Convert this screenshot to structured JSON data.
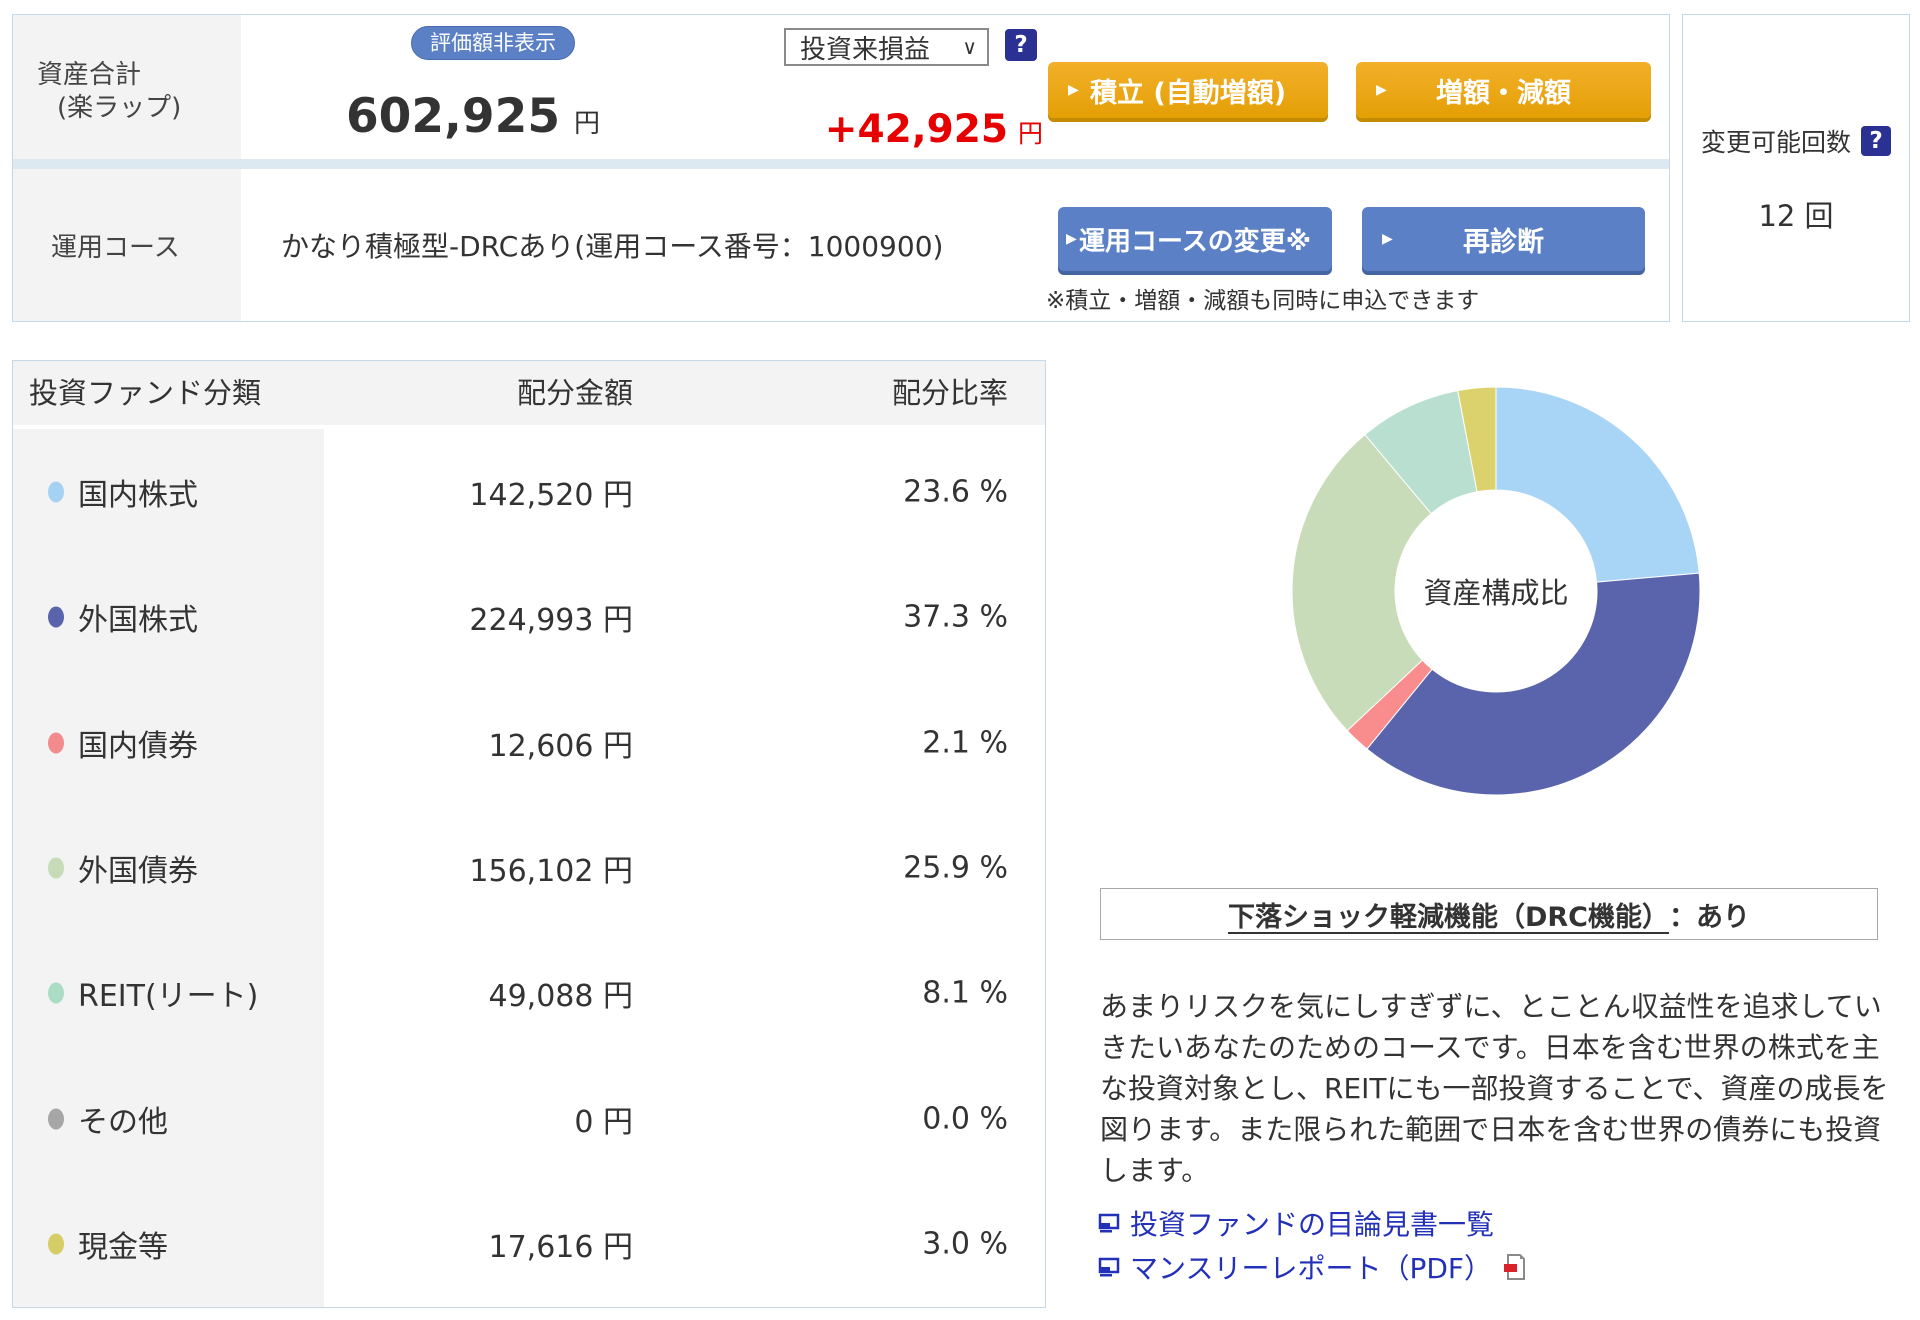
{
  "summary": {
    "asset_label_line1": "資産合計",
    "asset_label_line2": "(楽ラップ)",
    "hide_valuation_button": "評価額非表示",
    "total_amount": "602,925",
    "total_currency": "円",
    "pl_period_selected": "投資来損益",
    "pl_chevron": "∨",
    "pl_amount": "+42,925",
    "pl_currency": "円",
    "help_icon": "?",
    "arrow_icon": "▶",
    "accumulate_button": "積立 (自動増額)",
    "increase_decrease_button": "増額・減額"
  },
  "course": {
    "label": "運用コース",
    "value": "かなり積極型-DRCあり(運用コース番号：1000900)",
    "change_course_button": "運用コースの変更※",
    "rediagnose_button": "再診断",
    "note": "※積立・増額・減額も同時に申込できます"
  },
  "change_limit": {
    "label": "変更可能回数",
    "help_icon": "?",
    "value": "12 回"
  },
  "allocation_table": {
    "headers": [
      "投資ファンド分類",
      "配分金額",
      "配分比率"
    ],
    "rows": [
      {
        "label": "国内株式",
        "amount": "142,520 円",
        "ratio": "23.6 %",
        "color": "#a5d2f3"
      },
      {
        "label": "外国株式",
        "amount": "224,993 円",
        "ratio": "37.3 %",
        "color": "#5a64ac"
      },
      {
        "label": "国内債券",
        "amount": "12,606 円",
        "ratio": "2.1 %",
        "color": "#f28b8b"
      },
      {
        "label": "外国債券",
        "amount": "156,102 円",
        "ratio": "25.9 %",
        "color": "#c6dbb7"
      },
      {
        "label": "REIT(リート)",
        "amount": "49,088 円",
        "ratio": "8.1 %",
        "color": "#aaddc3"
      },
      {
        "label": "その他",
        "amount": "0 円",
        "ratio": "0.0 %",
        "color": "#a6a6a6"
      },
      {
        "label": "現金等",
        "amount": "17,616 円",
        "ratio": "3.0 %",
        "color": "#d6cd67"
      }
    ]
  },
  "chart_data": {
    "type": "pie",
    "donut": true,
    "center_label": "資産構成比",
    "categories": [
      "国内株式",
      "外国株式",
      "国内債券",
      "外国債券",
      "REIT(リート)",
      "その他",
      "現金等"
    ],
    "values": [
      23.6,
      37.3,
      2.1,
      25.9,
      8.1,
      0.0,
      3.0
    ],
    "unit": "%",
    "colors": [
      "#a8d4f5",
      "#5a64ac",
      "#f98d8d",
      "#c8dcb9",
      "#b9dfd0",
      "#a6a6a6",
      "#dbd26e"
    ],
    "start_angle_deg": 0,
    "direction": "clockwise",
    "outer_radius": 204,
    "inner_radius": 101
  },
  "drc": {
    "title_main": "下落ショック軽減機能（DRC機能）",
    "title_suffix": "：あり",
    "description": "あまりリスクを気にしすぎずに、とことん収益性を追求していきたいあなたのためのコースです。日本を含む世界の株式を主な投資対象とし、REITにも一部投資することで、資産の成長を図ります。また限られた範囲で日本を含む世界の債券にも投資します。"
  },
  "links": [
    {
      "label": "投資ファンドの目論見書一覧",
      "pdf": false
    },
    {
      "label": "マンスリーレポート（PDF）",
      "pdf": true
    }
  ]
}
